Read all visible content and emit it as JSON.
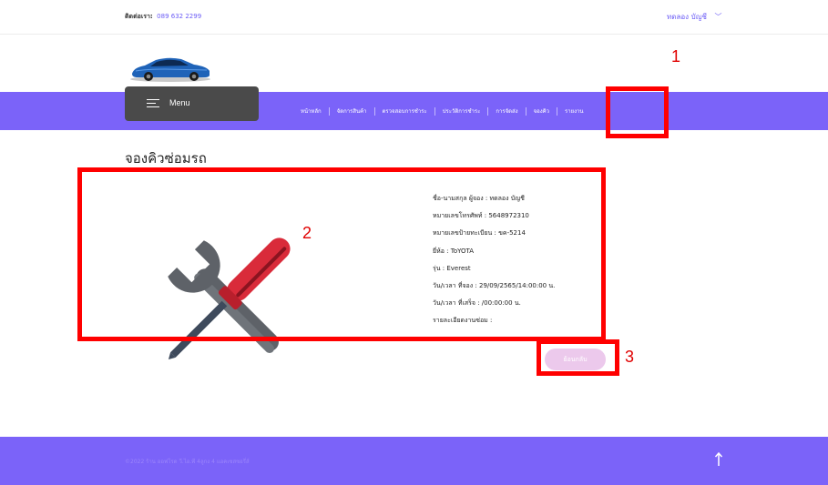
{
  "topbar": {
    "contact_label": "ติดต่อเรา:",
    "contact_phone": "089 632 2299",
    "account_name": "ทดลอง บัญชี",
    "account_chevron": "﹀"
  },
  "menu": {
    "label": "Menu"
  },
  "nav": {
    "items": [
      "หน้าหลัก",
      "จัดการสินค้า",
      "ตรวจสอบการชำระ",
      "ประวัติการชำระ",
      "การจัดส่ง",
      "จองคิว",
      "รายงาน"
    ]
  },
  "annotations": [
    "1",
    "2",
    "3"
  ],
  "page": {
    "title": "จองคิวซ่อมรถ"
  },
  "booking": {
    "lines": [
      "ชื่อ-นามสกุล ผู้จอง : ทดลอง บัญชี",
      "หมายเลขโทรศัพท์ : 5648972310",
      "หมายเลขป้ายทะเบียน : ขค-5214",
      "ยี่ห้อ : ToYOTA",
      "รุ่น : Everest",
      "วัน/เวลา ที่จอง : 29/09/2565/14:00:00 น.",
      "วัน/เวลา ที่เสร็จ : /00:00:00 น.",
      "รายละเอียดงานซ่อม :"
    ]
  },
  "actions": {
    "back_label": "ย้อนกลับ"
  },
  "footer": {
    "copyright": "©2022 ร้าน ออฟโรด วี.ไอ.พี 4ลูกง 4 แอคเซสซอรี่ส์"
  },
  "colors": {
    "brand": "#7b63f9",
    "menu_bg": "#4a4a4a",
    "annotation": "#ff0000",
    "back_button": "#ecc9ec"
  },
  "icons": [
    "car-logo-icon",
    "hamburger-icon",
    "chevron-down-icon",
    "tools-icon",
    "arrow-up-icon"
  ]
}
